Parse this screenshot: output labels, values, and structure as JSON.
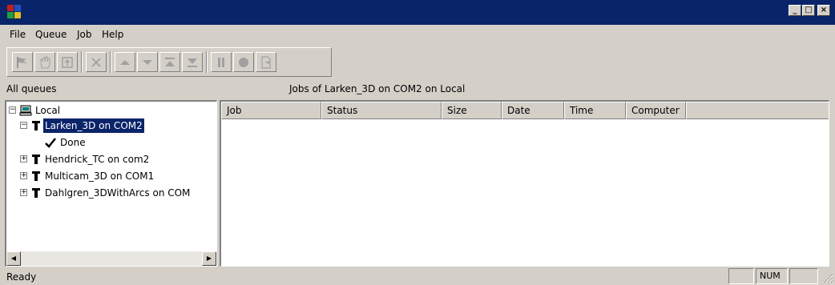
{
  "window": {
    "minimize_label": "_",
    "maximize_label": "□",
    "close_label": "×"
  },
  "menu": {
    "items": [
      {
        "label": "File"
      },
      {
        "label": "Queue"
      },
      {
        "label": "Job"
      },
      {
        "label": "Help"
      }
    ]
  },
  "toolbar": {
    "buttons": [
      {
        "icon": "flag-icon"
      },
      {
        "icon": "hand-icon"
      },
      {
        "icon": "refresh-icon"
      },
      {
        "icon": "delete-icon"
      },
      {
        "icon": "move-up-icon"
      },
      {
        "icon": "move-down-icon"
      },
      {
        "icon": "move-top-icon"
      },
      {
        "icon": "move-bottom-icon"
      },
      {
        "icon": "pause-icon"
      },
      {
        "icon": "record-icon"
      },
      {
        "icon": "export-icon"
      }
    ]
  },
  "left_pane": {
    "label": "All queues"
  },
  "right_pane": {
    "label": "Jobs of Larken_3D on COM2 on Local"
  },
  "tree": {
    "root": {
      "label": "Local",
      "expander": "−"
    },
    "nodes": [
      {
        "label": "Larken_3D on COM2",
        "expander": "−",
        "selected": true,
        "children": [
          {
            "label": "Done",
            "icon": "checkmark-icon"
          }
        ]
      },
      {
        "label": "Hendrick_TC on com2",
        "expander": "+"
      },
      {
        "label": "Multicam_3D on COM1",
        "expander": "+"
      },
      {
        "label": "Dahlgren_3DWithArcs on COM",
        "expander": "+"
      }
    ],
    "scroll_left": "◀",
    "scroll_right": "▶"
  },
  "list": {
    "columns": [
      "Job",
      "Status",
      "Size",
      "Date",
      "Time",
      "Computer"
    ],
    "rows": []
  },
  "status_bar": {
    "text": "Ready",
    "num_indicator": "NUM"
  },
  "colors": {
    "title_bar": "#0a246a",
    "face": "#d4d0c8",
    "selection": "#0a246a"
  }
}
